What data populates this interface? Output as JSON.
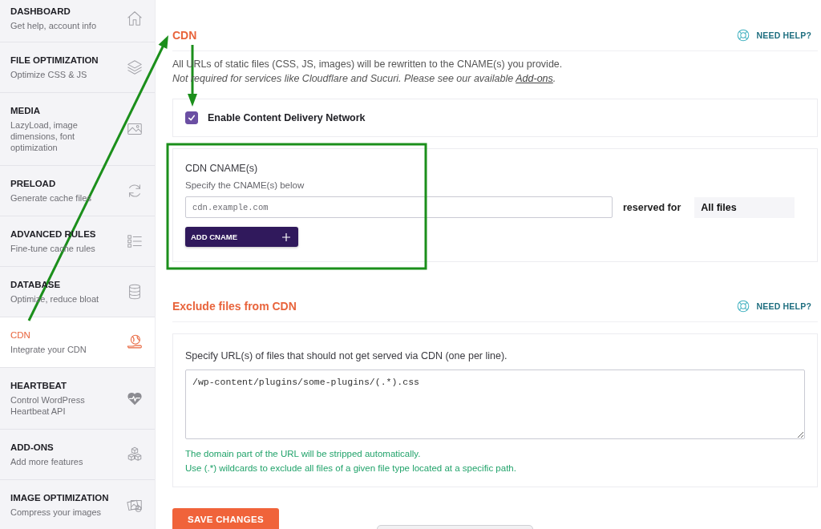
{
  "sidebar": {
    "items": [
      {
        "title": "DASHBOARD",
        "subtitle": "Get help, account info",
        "selected": false
      },
      {
        "title": "FILE OPTIMIZATION",
        "subtitle": "Optimize CSS & JS",
        "selected": false
      },
      {
        "title": "MEDIA",
        "subtitle": "LazyLoad, image dimensions, font optimization",
        "selected": false
      },
      {
        "title": "PRELOAD",
        "subtitle": "Generate cache files",
        "selected": false
      },
      {
        "title": "ADVANCED RULES",
        "subtitle": "Fine-tune cache rules",
        "selected": false
      },
      {
        "title": "DATABASE",
        "subtitle": "Optimize, reduce bloat",
        "selected": false
      },
      {
        "title": "CDN",
        "subtitle": "Integrate your CDN",
        "selected": true
      },
      {
        "title": "HEARTBEAT",
        "subtitle": "Control WordPress Heartbeat API",
        "selected": false
      },
      {
        "title": "ADD-ONS",
        "subtitle": "Add more features",
        "selected": false
      },
      {
        "title": "IMAGE OPTIMIZATION",
        "subtitle": "Compress your images",
        "selected": false
      }
    ]
  },
  "sections": [
    {
      "title": "CDN",
      "help": "NEED HELP?",
      "description": "All URLs of static files (CSS, JS, images) will be rewritten to the CNAME(s) you provide.",
      "note": {
        "text": "Not required for services like Cloudflare and Sucuri. Please see our available",
        "link": "Add-ons",
        "end": "."
      },
      "enable": {
        "label": "Enable Content Delivery Network",
        "checked": true
      },
      "cnames": {
        "label": "CDN CNAME(s)",
        "hint": "Specify the CNAME(s) below",
        "placeholder": "cdn.example.com",
        "reserved_label": "reserved for",
        "reserved_value": "All files",
        "button": "ADD CNAME"
      }
    },
    {
      "title": "Exclude files from CDN",
      "help": "NEED HELP?",
      "exclude": {
        "label": "Specify URL(s) of files that should not get served via CDN (one per line).",
        "value": "/wp-content/plugins/some-plugins/(.*).css",
        "notes": [
          "The domain part of the URL will be stripped automatically.",
          "Use (.*) wildcards to exclude all files of a given file type located at a specific path."
        ]
      }
    }
  ],
  "save_button": "SAVE CHANGES",
  "annotations": [
    {
      "kind": "arrow"
    },
    {
      "kind": "arrow"
    },
    {
      "kind": "frame"
    }
  ]
}
